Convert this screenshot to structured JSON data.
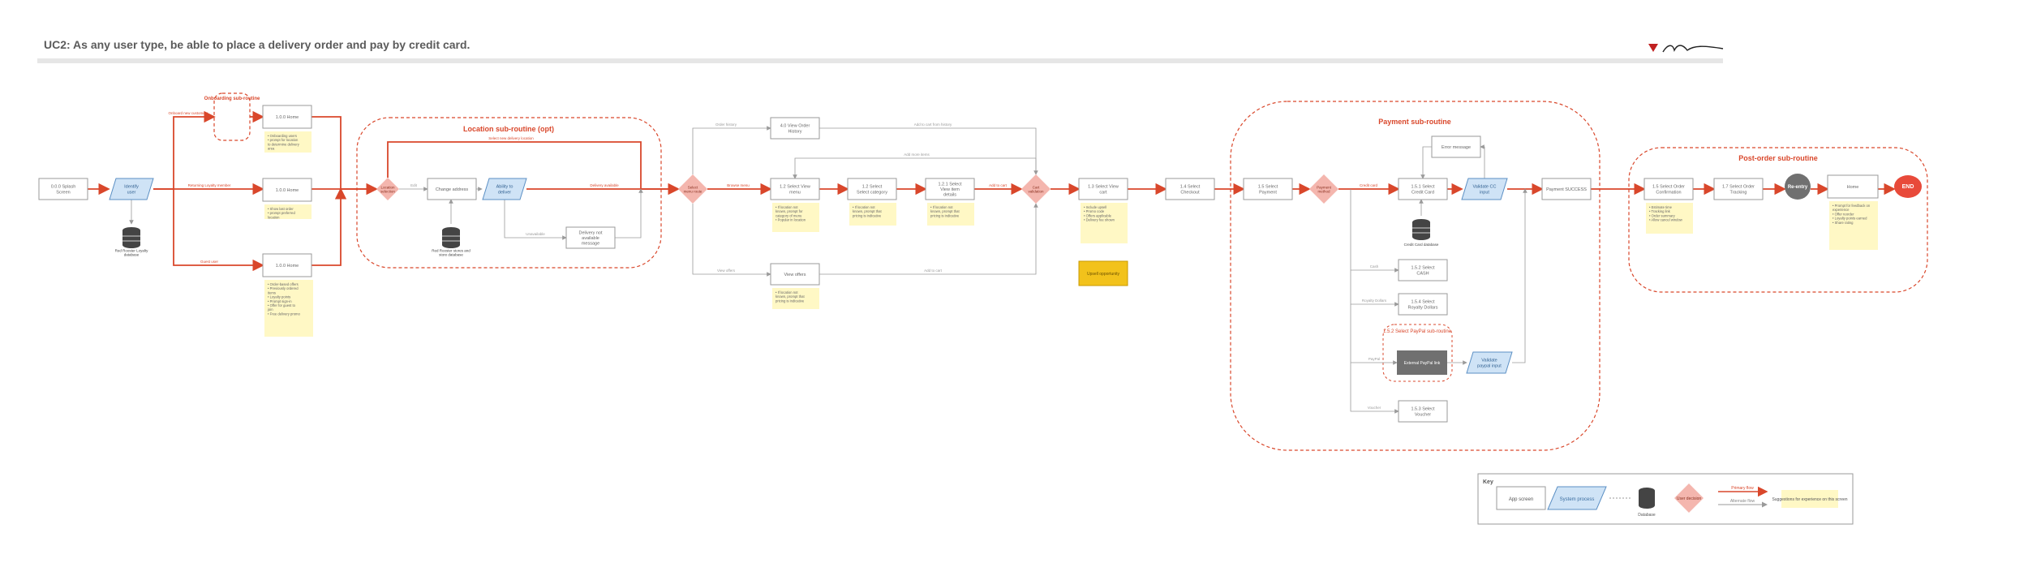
{
  "header": {
    "title": "UC2: As any user type, be able to place a delivery order and pay by credit card."
  },
  "colors": {
    "flow": "#d9472b",
    "screen_stroke": "#9a9a9a",
    "process_fill": "#cfe3f6",
    "process_stroke": "#5b8fc4",
    "decision_fill": "#f4b6ae",
    "note_fill": "#fff8c5",
    "database_fill": "#444444",
    "end_fill": "#e84a3a",
    "reentry_fill": "#707070",
    "highlight_fill": "#f2c21b"
  },
  "groups": {
    "location": "Location sub-routine (opt)",
    "payment": "Payment sub-routine",
    "postorder": "Post-order sub-routine",
    "onboarding": "Onboarding sub-routine"
  },
  "screens": {
    "splash": "0.0.0 Splash Screen",
    "home_top": "1.0.0 Home",
    "home_mid": "1.0.0 Home",
    "home_bot": "1.0.0 Home",
    "change_address": "Change address",
    "delivery_msg": "Delivery not available message",
    "order_history": "4.0 View Order History",
    "view_menu": "1.2 Select View menu",
    "select_category": "1.2 Select Select category",
    "view_item": "1.2.1 Select View item details",
    "view_cart": "1.3 Select View cart",
    "checkout": "1.4 Select Checkout",
    "payment": "1.5 Select Payment",
    "view_offers": "View offers",
    "error_message": "Error message",
    "credit_card": "1.5.1 Select Credit Card",
    "payment_success": "Payment SUCCESS",
    "order_confirm": "1.5 Select Order Confirmation",
    "order_tracking": "1.7 Select Order Tracking",
    "home_end": "Home",
    "cash": "1.5.2 Select CASH",
    "loyalty": "1.5.4 Select Royalty Dollars",
    "voucher": "1.5.3 Select Voucher"
  },
  "processes": {
    "id_user": "Identify user",
    "apply_to_deliver": "Ability to deliver",
    "validate_cc": "Validate CC input",
    "validate_paypal": "Validate paypal input",
    "external_paypal": "External PayPal link"
  },
  "decisions": {
    "d_location": "Location selection",
    "d_menu": "Select menu route",
    "d_cart": "Cart validation",
    "d_payment": "Payment method"
  },
  "paypal_sub": "1.5.2 Select PayPal sub-routine",
  "databases": {
    "user": "Red Rooster Loyalty database",
    "stores": "Red Rooster stores and store database",
    "cc": "Credit Card database"
  },
  "edges": {
    "e_onboard": "Onboard new customers",
    "e_loyalty": "Returning Loyalty member",
    "e_guest": "Guest user",
    "e_select_loc": "Select new delivery location",
    "e_edit": "Edit",
    "e_available": "Delivery available",
    "e_unavail": "Unavailable",
    "e_returning": "Add to cart from history",
    "e_history": "Order history",
    "e_menu": "Browse menu",
    "e_offers": "View offers",
    "e_add": "Add to cart",
    "e_add2": "Add to cart",
    "e_more": "Add more items",
    "e_pay": "Credit card",
    "e_cash": "Cash",
    "e_loyal": "Royalty Dollars",
    "e_paypal": "PayPal",
    "e_voucher": "Voucher"
  },
  "notes": {
    "n_home_top": "Onboarding users; prompt for location to determine delivery area",
    "n_home_mid": "Show last order; prompt preferred location",
    "n_home_bot": "Order-based offers; Previously ordered items; Loyalty points; Prompt sign-in; Offer for guest to join; Free delivery promo",
    "n_menu": "If location not known, prompt for category of menu; Popular in location",
    "n_category": "If location not known, prompt that pricing is indicative",
    "n_item": "If location not known, prompt that pricing is indicative",
    "n_cart": "Include upsell; Promo code; Offers applicable; Delivery fee shown",
    "n_offers": "If location not known, prompt that pricing is indicative",
    "n_confirm": "Estimate time; Tracking link; Order summary; Allow cancel window",
    "n_home_end": "Prompt for feedback on experience; Offer reorder; Loyalty points earned; Share rating"
  },
  "highlight": "Upsell opportunity",
  "reentry_label": "Re-entry",
  "end_label": "END",
  "key": {
    "title": "Key",
    "screen": "App screen",
    "process": "System process",
    "database": "Database",
    "decision": "User decision",
    "arrow_primary": "Primary flow",
    "arrow_alt": "Alternate flow",
    "note": "Suggestions for experience on this screen"
  }
}
